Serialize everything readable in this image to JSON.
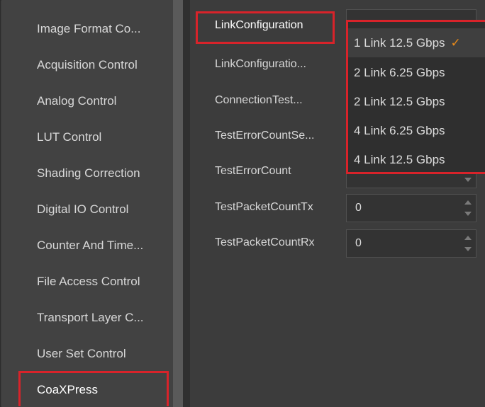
{
  "sidebar": {
    "items": [
      {
        "label": "Image Format Co..."
      },
      {
        "label": "Acquisition Control"
      },
      {
        "label": "Analog Control"
      },
      {
        "label": "LUT Control"
      },
      {
        "label": "Shading Correction"
      },
      {
        "label": "Digital IO Control"
      },
      {
        "label": "Counter And Time..."
      },
      {
        "label": "File Access Control"
      },
      {
        "label": "Transport Layer C..."
      },
      {
        "label": "User Set Control"
      },
      {
        "label": "CoaXPress"
      }
    ],
    "selected": "CoaXPress"
  },
  "properties": [
    {
      "label": "LinkConfiguration"
    },
    {
      "label": "LinkConfiguratio..."
    },
    {
      "label": "ConnectionTest..."
    },
    {
      "label": "TestErrorCountSe..."
    },
    {
      "label": "TestErrorCount"
    },
    {
      "label": "TestPacketCountTx",
      "value": "0"
    },
    {
      "label": "TestPacketCountRx",
      "value": "0"
    }
  ],
  "dropdown": {
    "options": [
      {
        "label": "1 Link 12.5 Gbps",
        "selected": true
      },
      {
        "label": "2 Link 6.25 Gbps"
      },
      {
        "label": "2 Link 12.5 Gbps"
      },
      {
        "label": "4 Link 6.25 Gbps"
      },
      {
        "label": "4 Link 12.5 Gbps"
      }
    ],
    "check_glyph": "✓"
  },
  "colors": {
    "highlight": "#d8232a",
    "check": "#e88a1a"
  }
}
